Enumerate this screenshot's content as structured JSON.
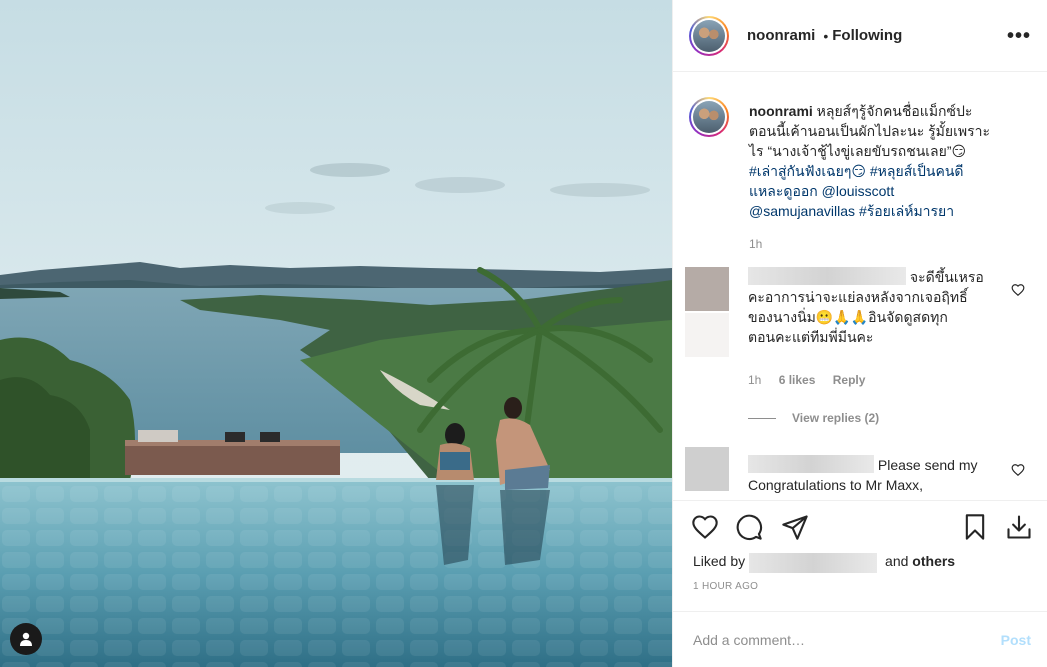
{
  "post": {
    "username": "noonrami",
    "follow_status": "Following",
    "more_icon": "more-options-icon"
  },
  "caption": {
    "username": "noonrami",
    "text_line1": "หลุยส์ๆรู้จักคนชื่อแม็กซ์ปะ",
    "text_line2": "ตอนนี้เค้านอนเป็นผักไปละนะ รู้มั้ยเพราะ",
    "text_line3": "ไร “นางเจ้าชู้ไงขู่เลยขับรถชนเลย”😏",
    "hashtag1": "#เล่าสู่กันฟังเฉยๆ😏",
    "hashtag2": "#หลุยส์เป็นคนดี",
    "line5_a": "แหละดูออก",
    "mention1": "@louisscott",
    "mention2": "@samujanavillas",
    "hashtag3": "#ร้อยเล่ห์มารยา",
    "time": "1h"
  },
  "comments": [
    {
      "text_line1": "จะดีขึ้นเหรอ",
      "text_line2": "คะอาการน่าจะแย่ลงหลังจากเจอฤิทธิ์",
      "text_line3": "ของนางนิ่ม😬🙏🙏อินจัดดูสดทุก",
      "text_line4": "ตอนคะแต่ทีมพี่มีนคะ",
      "time": "1h",
      "likes": "6 likes",
      "reply": "Reply",
      "view_replies": "View replies (2)"
    },
    {
      "text_line1": "Please send my",
      "text_line2": "Congratulations to Mr Maxx,"
    }
  ],
  "actions": {
    "liked_by_prefix": "Liked by",
    "and": "and",
    "others": "others",
    "post_time": "1 HOUR AGO"
  },
  "add_comment": {
    "placeholder": "Add a comment…",
    "post_label": "Post"
  },
  "colors": {
    "link": "#00376b",
    "secondary": "#8e8e8e",
    "post_disabled": "#b2dffc"
  }
}
